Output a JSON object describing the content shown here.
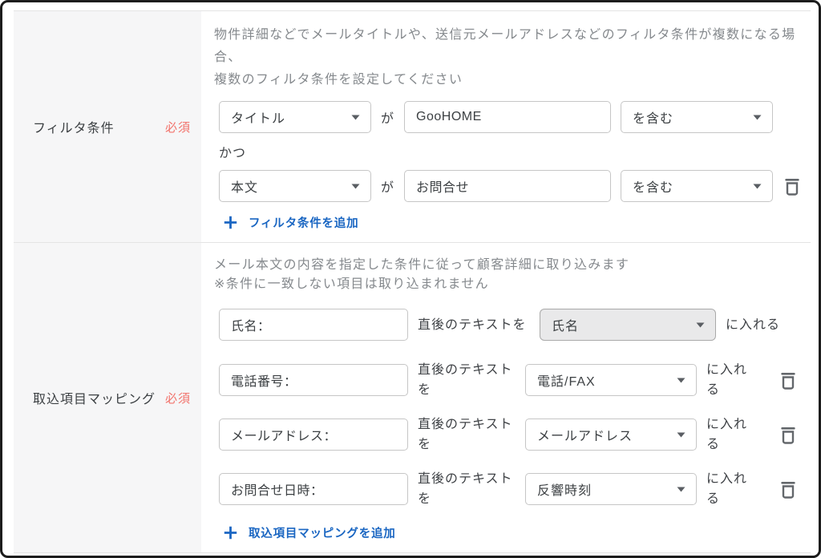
{
  "colors": {
    "accent_blue": "#1a66c2",
    "required_red": "#f2736c",
    "label_bg": "#f6f6f7",
    "border_gray": "#c6c6c6",
    "disabled_bg": "#e9e9ea"
  },
  "filter_section": {
    "label": "フィルタ条件",
    "required_badge": "必須",
    "description": "物件詳細などでメールタイトルや、送信元メールアドレスなどのフィルタ条件が複数になる場\n合、\n複数のフィルタ条件を設定してください",
    "conjunction": "かつ",
    "rows": [
      {
        "field": "タイトル",
        "connector": "が",
        "value": "GooHOME",
        "operator": "を含む"
      },
      {
        "field": "本文",
        "connector": "が",
        "value": "お問合せ",
        "operator": "を含む"
      }
    ],
    "add_link": "フィルタ条件を追加"
  },
  "mapping_section": {
    "label": "取込項目マッピング",
    "required_badge": "必須",
    "description": "メール本文の内容を指定した条件に従って顧客詳細に取り込みます\n※条件に一致しない項目は取り込まれません",
    "rows": [
      {
        "prefix": "氏名：",
        "mid_text": "直後のテキストを",
        "target": "氏名",
        "suffix": "に入れる"
      },
      {
        "prefix": "電話番号：",
        "mid_text": "直後のテキスト\nを",
        "target": "電話/FAX",
        "suffix": "に入れ\nる"
      },
      {
        "prefix": "メールアドレス：",
        "mid_text": "直後のテキスト\nを",
        "target": "メールアドレス",
        "suffix": "に入れ\nる"
      },
      {
        "prefix": "お問合せ日時：",
        "mid_text": "直後のテキスト\nを",
        "target": "反響時刻",
        "suffix": "に入れ\nる"
      }
    ],
    "add_link": "取込項目マッピングを追加"
  }
}
